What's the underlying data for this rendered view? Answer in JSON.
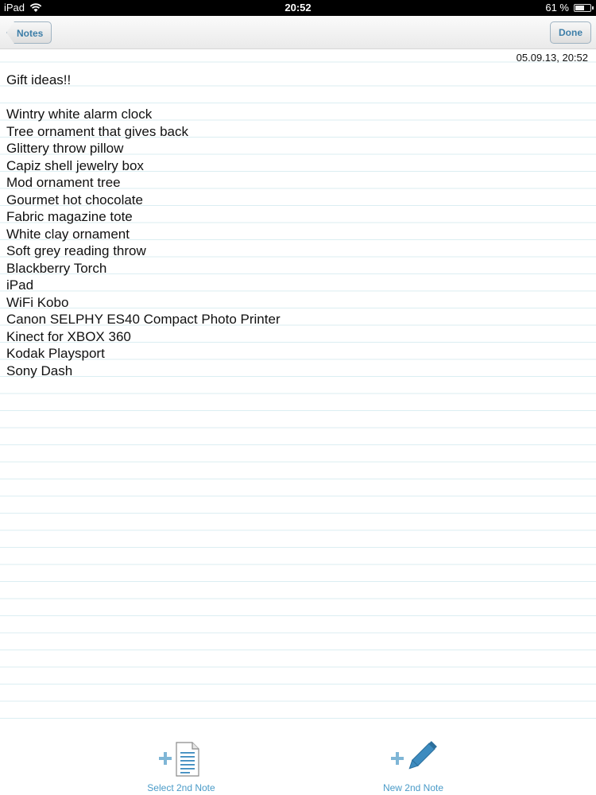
{
  "status_bar": {
    "device": "iPad",
    "time": "20:52",
    "battery": "61 %",
    "battery_level": 0.61
  },
  "navbar": {
    "back_label": "Notes",
    "done_label": "Done"
  },
  "note": {
    "timestamp": "05.09.13, 20:52",
    "lines": [
      "Gift ideas!!",
      "",
      "Wintry white alarm clock",
      "Tree ornament that gives back",
      "Glittery throw pillow",
      "Capiz shell jewelry box",
      "Mod ornament tree",
      "Gourmet hot chocolate",
      "Fabric magazine tote",
      "White clay ornament",
      "Soft grey reading throw",
      "Blackberry Torch",
      "iPad",
      "WiFi Kobo",
      "Canon SELPHY ES40 Compact Photo Printer",
      "Kinect for XBOX 360",
      "Kodak Playsport",
      "Sony Dash"
    ]
  },
  "toolbar": {
    "select_label": "Select 2nd Note",
    "new_label": "New 2nd Note",
    "select_icon": "document-plus-icon",
    "new_icon": "pencil-plus-icon",
    "accent": "#4a9bc8"
  }
}
